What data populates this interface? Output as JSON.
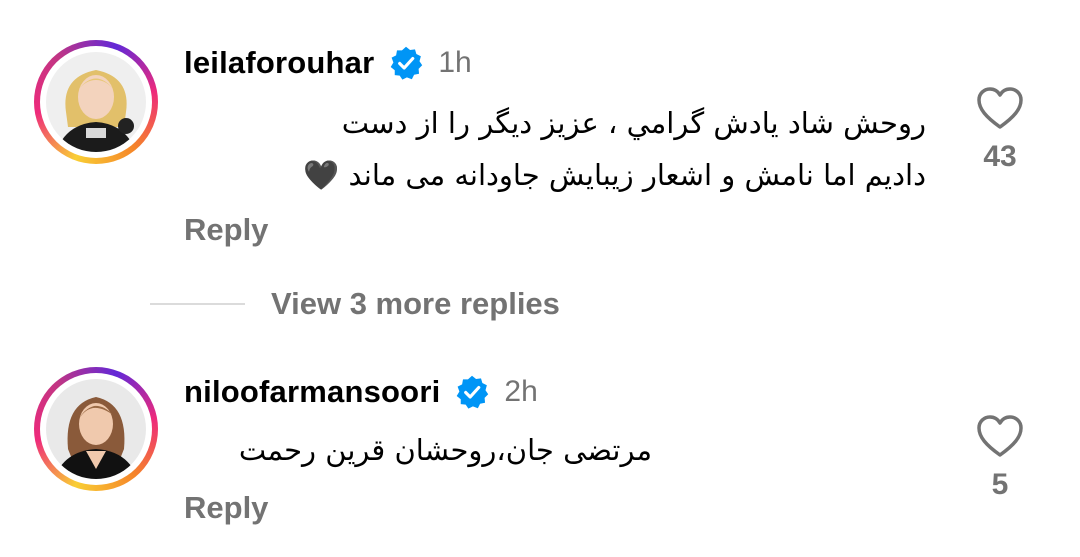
{
  "comments": [
    {
      "username": "leilaforouhar",
      "time": "1h",
      "text_line1": "روحش شاد یادش گرامي ، عزیز دیگر را از دست",
      "text_line2": "دادیم اما نامش و اشعار زیبایش جاودانه می ماند",
      "emoji": "🖤",
      "reply_label": "Reply",
      "likes": "43"
    },
    {
      "username": "niloofarmansoori",
      "time": "2h",
      "text_line1": "مرتضی جان،روحشان قرین رحمت",
      "reply_label": "Reply",
      "likes": "5"
    }
  ],
  "view_more_label": "View 3 more replies",
  "colors": {
    "secondary_text": "#737373",
    "verified_blue": "#0095f6",
    "divider": "#dbdbdb"
  },
  "icons": [
    "heart-icon",
    "verified-badge-icon"
  ]
}
